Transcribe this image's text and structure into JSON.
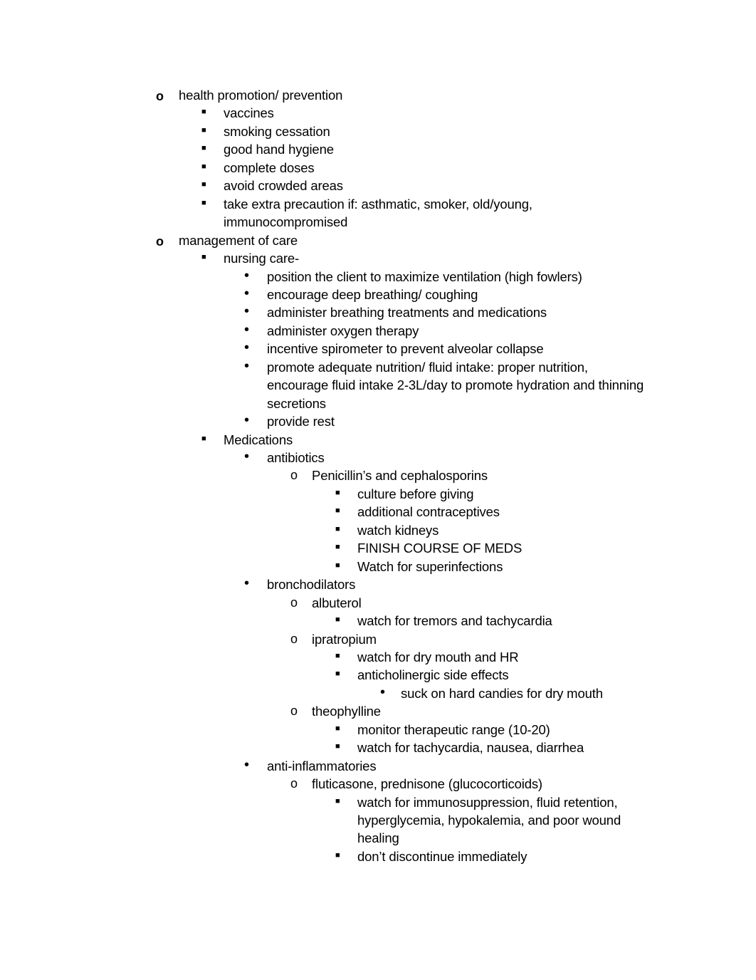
{
  "document": {
    "items": [
      {
        "level": 0,
        "bullet": "o",
        "text": "health promotion/ prevention",
        "lines": 1
      },
      {
        "level": 1,
        "bullet": "■",
        "text": "vaccines",
        "lines": 1
      },
      {
        "level": 1,
        "bullet": "■",
        "text": "smoking cessation",
        "lines": 1
      },
      {
        "level": 1,
        "bullet": "■",
        "text": "good hand hygiene",
        "lines": 1
      },
      {
        "level": 1,
        "bullet": "■",
        "text": "complete doses",
        "lines": 1
      },
      {
        "level": 1,
        "bullet": "■",
        "text": "avoid crowded areas",
        "lines": 1
      },
      {
        "level": 1,
        "bullet": "■",
        "text": "take extra precaution if: asthmatic, smoker, old/young, immunocompromised",
        "lines": 2
      },
      {
        "level": 0,
        "bullet": "o",
        "text": "management of care",
        "lines": 1
      },
      {
        "level": 1,
        "bullet": "■",
        "text": "nursing care-",
        "lines": 1
      },
      {
        "level": 2,
        "bullet": "•",
        "text": "position the client to maximize ventilation (high fowlers)",
        "lines": 1
      },
      {
        "level": 2,
        "bullet": "•",
        "text": "encourage deep breathing/ coughing",
        "lines": 1
      },
      {
        "level": 2,
        "bullet": "•",
        "text": "administer breathing treatments and medications",
        "lines": 1
      },
      {
        "level": 2,
        "bullet": "•",
        "text": "administer oxygen therapy",
        "lines": 1
      },
      {
        "level": 2,
        "bullet": "•",
        "text": "incentive spirometer to prevent alveolar collapse",
        "lines": 1
      },
      {
        "level": 2,
        "bullet": "•",
        "text": "promote adequate nutrition/ fluid intake: proper nutrition, encourage fluid intake 2-3L/day to promote hydration and thinning secretions",
        "lines": 3
      },
      {
        "level": 2,
        "bullet": "•",
        "text": "provide rest",
        "lines": 1
      },
      {
        "level": 1,
        "bullet": "■",
        "text": "Medications",
        "lines": 1
      },
      {
        "level": 2,
        "bullet": "•",
        "text": "antibiotics",
        "lines": 1
      },
      {
        "level": 3,
        "bullet": "o",
        "text": "Penicillin’s and cephalosporins",
        "lines": 1
      },
      {
        "level": 4,
        "bullet": "■",
        "text": "culture before giving",
        "lines": 1
      },
      {
        "level": 4,
        "bullet": "■",
        "text": "additional contraceptives",
        "lines": 1
      },
      {
        "level": 4,
        "bullet": "■",
        "text": "watch kidneys",
        "lines": 1
      },
      {
        "level": 4,
        "bullet": "■",
        "text": "FINISH COURSE OF MEDS",
        "lines": 1
      },
      {
        "level": 4,
        "bullet": "■",
        "text": "Watch for superinfections",
        "lines": 1
      },
      {
        "level": 2,
        "bullet": "•",
        "text": "bronchodilators",
        "lines": 1
      },
      {
        "level": 3,
        "bullet": "o",
        "text": "albuterol",
        "lines": 1
      },
      {
        "level": 4,
        "bullet": "■",
        "text": "watch for tremors and tachycardia",
        "lines": 1
      },
      {
        "level": 3,
        "bullet": "o",
        "text": "ipratropium",
        "lines": 1
      },
      {
        "level": 4,
        "bullet": "■",
        "text": "watch for dry mouth and HR",
        "lines": 1
      },
      {
        "level": 4,
        "bullet": "■",
        "text": "anticholinergic side effects",
        "lines": 1
      },
      {
        "level": 5,
        "bullet": "•",
        "text": "suck on hard candies for dry mouth",
        "lines": 1
      },
      {
        "level": 3,
        "bullet": "o",
        "text": "theophylline",
        "lines": 1
      },
      {
        "level": 4,
        "bullet": "■",
        "text": "monitor therapeutic range (10-20)",
        "lines": 1
      },
      {
        "level": 4,
        "bullet": "■",
        "text": "watch for tachycardia, nausea, diarrhea",
        "lines": 1
      },
      {
        "level": 2,
        "bullet": "•",
        "text": "anti-inflammatories",
        "lines": 1
      },
      {
        "level": 3,
        "bullet": "o",
        "text": "fluticasone, prednisone (glucocorticoids)",
        "lines": 1
      },
      {
        "level": 4,
        "bullet": "■",
        "text": "watch for immunosuppression, fluid retention, hyperglycemia, hypokalemia, and poor wound healing",
        "lines": 3
      },
      {
        "level": 4,
        "bullet": "■",
        "text": "don’t discontinue immediately",
        "lines": 1
      }
    ]
  }
}
